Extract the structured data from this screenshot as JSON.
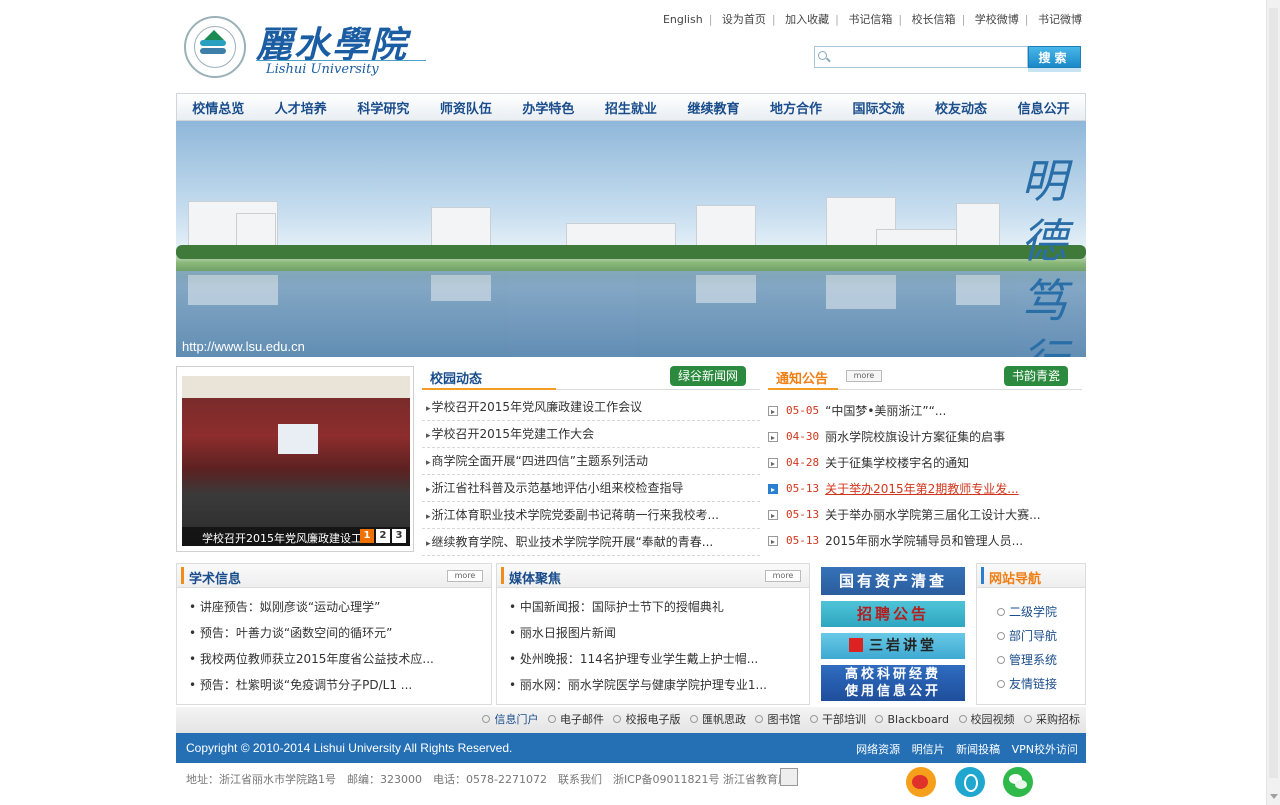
{
  "logo": {
    "name_cn": "麗水學院",
    "name_en": "Lishui University"
  },
  "toplinks": [
    "English",
    "设为首页",
    "加入收藏",
    "书记信箱",
    "校长信箱",
    "学校微博",
    "书记微博"
  ],
  "search": {
    "placeholder": "",
    "button_label": "搜索"
  },
  "nav": [
    "校情总览",
    "人才培养",
    "科学研究",
    "师资队伍",
    "办学特色",
    "招生就业",
    "继续教育",
    "地方合作",
    "国际交流",
    "校友动态",
    "信息公开"
  ],
  "banner": {
    "calligraphy": "明德笃行",
    "url": "http://www.lsu.edu.cn"
  },
  "photo": {
    "caption": "学校召开2015年党风廉政建设工",
    "pages": [
      "1",
      "2",
      "3"
    ],
    "active_page": "1"
  },
  "campus_news": {
    "title": "校园动态",
    "button": "绿谷新闻网",
    "items": [
      "学校召开2015年党风廉政建设工作会议",
      "学校召开2015年党建工作大会",
      "商学院全面开展“四进四信”主题系列活动",
      "浙江省社科普及示范基地评估小组来校检查指导",
      "浙江体育职业技术学院党委副书记蒋萌一行来我校考...",
      "继续教育学院、职业技术学院学院开展“奉献的青春..."
    ]
  },
  "notices": {
    "title": "通知公告",
    "more": "more",
    "button": "书韵青瓷",
    "items": [
      {
        "date": "05-05",
        "text": "“中国梦•美丽浙江”“..."
      },
      {
        "date": "04-30",
        "text": "丽水学院校旗设计方案征集的启事"
      },
      {
        "date": "04-28",
        "text": "关于征集学校楼宇名的通知"
      },
      {
        "date": "05-13",
        "text": "关于举办2015年第2期教师专业发..."
      },
      {
        "date": "05-13",
        "text": "关于举办丽水学院第三届化工设计大赛..."
      },
      {
        "date": "05-13",
        "text": "2015年丽水学院辅导员和管理人员..."
      }
    ]
  },
  "academic": {
    "title": "学术信息",
    "more": "more",
    "items": [
      "• 讲座预告：姒刚彦谈“运动心理学”",
      "• 预告：叶善力谈“函数空间的循环元”",
      "• 我校两位教师获立2015年度省公益技术应...",
      "• 预告：杜紫明谈“免疫调节分子PD/L1 ..."
    ]
  },
  "media": {
    "title": "媒体聚焦",
    "more": "more",
    "items": [
      "• 中国新闻报：国际护士节下的授帽典礼",
      "• 丽水日报图片新闻",
      "• 处州晚报：114名护理专业学生戴上护士帽...",
      "• 丽水网：丽水学院医学与健康学院护理专业1..."
    ]
  },
  "side_banners": [
    "国有资产清查",
    "招聘公告",
    "三岩讲堂",
    "高校科研经费",
    "使用信息公开"
  ],
  "site_nav": {
    "title": "网站导航",
    "items": [
      "二级学院",
      "部门导航",
      "管理系统",
      "友情链接"
    ]
  },
  "bottom_links": [
    "信息门户",
    "电子邮件",
    "校报电子版",
    "匯帆思政",
    "图书馆",
    "干部培训",
    "Blackboard",
    "校园视频",
    "采购招标"
  ],
  "footer": {
    "copyright": "Copyright © 2010-2014 Lishui University All Rights Reserved.",
    "links": [
      "网络资源",
      "明信片",
      "新闻投稿",
      "VPN校外访问"
    ],
    "address": "地址：浙江省丽水市学院路1号　邮编：323000　电话：0578-2271072　联系我们　浙ICP备09011821号 浙江省教育厅"
  },
  "colors": {
    "nav_text": "#1a4d8c",
    "accent_orange": "#f07e12",
    "footer_blue": "#2570b5",
    "green_button": "#2b8a3e",
    "date_red": "#d1361c"
  },
  "icons": [
    "search-icon",
    "arrow-icon",
    "weibo-icon",
    "tencent-weibo-icon",
    "wechat-icon"
  ]
}
